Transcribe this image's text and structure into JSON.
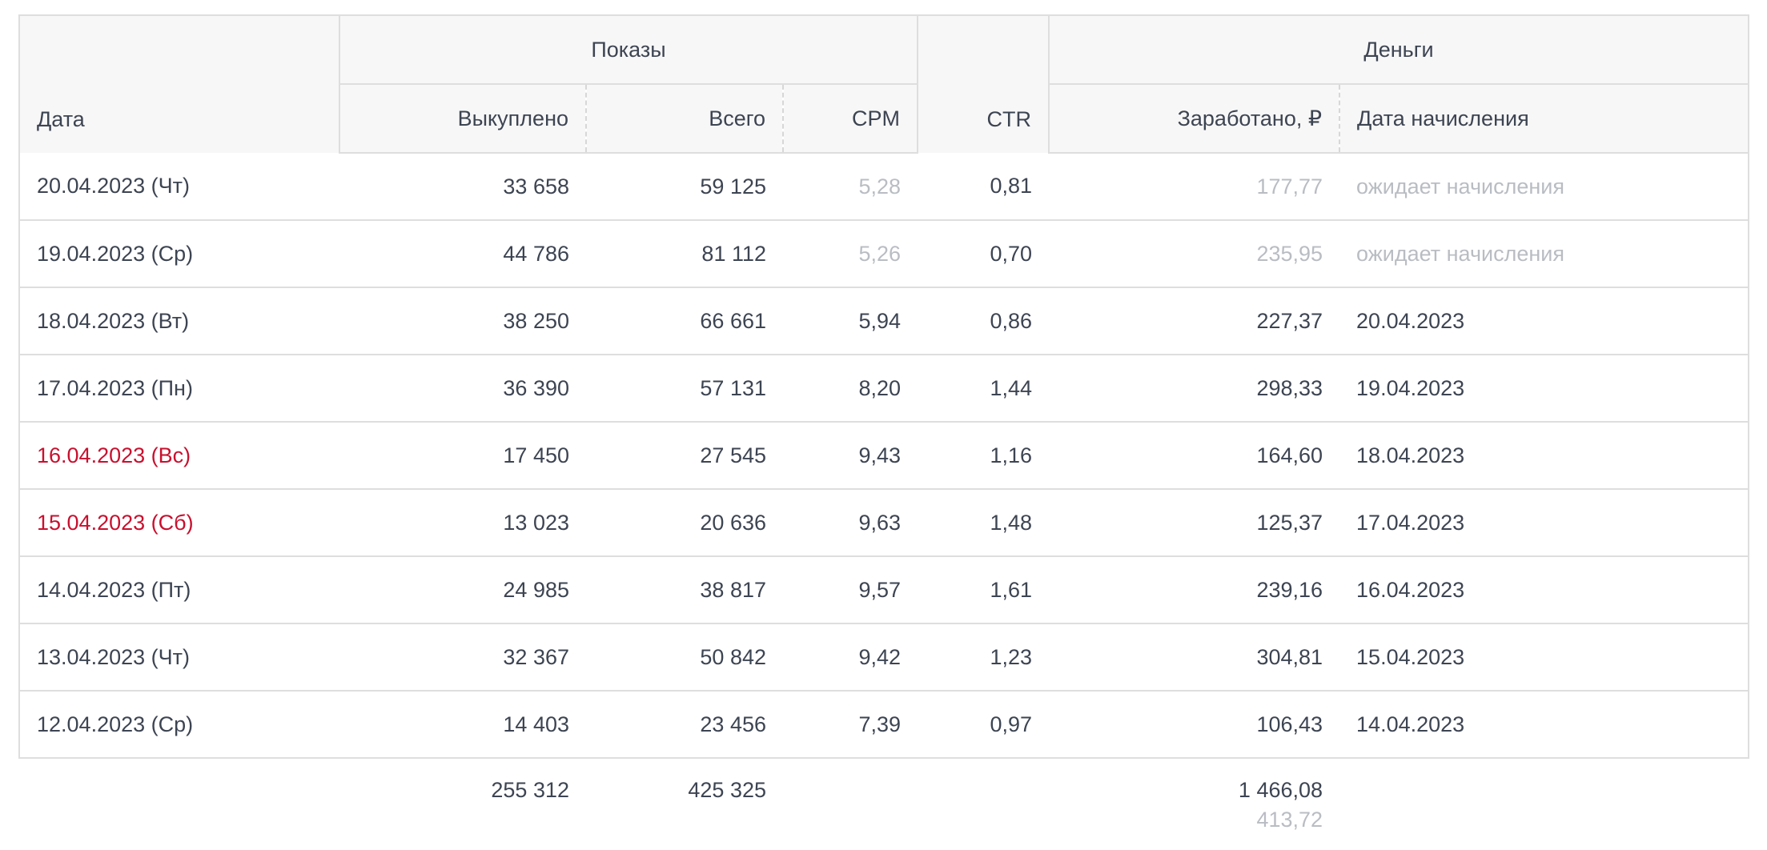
{
  "headers": {
    "date": "Дата",
    "group_impressions": "Показы",
    "purchased": "Выкуплено",
    "total": "Всего",
    "cpm": "CPM",
    "ctr": "CTR",
    "group_money": "Деньги",
    "earned": "Заработано, ₽",
    "accrual_date": "Дата начисления"
  },
  "rows": [
    {
      "date": "20.04.2023 (Чт)",
      "purchased": "33 658",
      "total": "59 125",
      "cpm": "5,28",
      "ctr": "0,81",
      "earned": "177,77",
      "accrual": "ожидает начисления",
      "pending": true,
      "weekend": false
    },
    {
      "date": "19.04.2023 (Ср)",
      "purchased": "44 786",
      "total": "81 112",
      "cpm": "5,26",
      "ctr": "0,70",
      "earned": "235,95",
      "accrual": "ожидает начисления",
      "pending": true,
      "weekend": false
    },
    {
      "date": "18.04.2023 (Вт)",
      "purchased": "38 250",
      "total": "66 661",
      "cpm": "5,94",
      "ctr": "0,86",
      "earned": "227,37",
      "accrual": "20.04.2023",
      "pending": false,
      "weekend": false
    },
    {
      "date": "17.04.2023 (Пн)",
      "purchased": "36 390",
      "total": "57 131",
      "cpm": "8,20",
      "ctr": "1,44",
      "earned": "298,33",
      "accrual": "19.04.2023",
      "pending": false,
      "weekend": false
    },
    {
      "date": "16.04.2023 (Вс)",
      "purchased": "17 450",
      "total": "27 545",
      "cpm": "9,43",
      "ctr": "1,16",
      "earned": "164,60",
      "accrual": "18.04.2023",
      "pending": false,
      "weekend": true
    },
    {
      "date": "15.04.2023 (Сб)",
      "purchased": "13 023",
      "total": "20 636",
      "cpm": "9,63",
      "ctr": "1,48",
      "earned": "125,37",
      "accrual": "17.04.2023",
      "pending": false,
      "weekend": true
    },
    {
      "date": "14.04.2023 (Пт)",
      "purchased": "24 985",
      "total": "38 817",
      "cpm": "9,57",
      "ctr": "1,61",
      "earned": "239,16",
      "accrual": "16.04.2023",
      "pending": false,
      "weekend": false
    },
    {
      "date": "13.04.2023 (Чт)",
      "purchased": "32 367",
      "total": "50 842",
      "cpm": "9,42",
      "ctr": "1,23",
      "earned": "304,81",
      "accrual": "15.04.2023",
      "pending": false,
      "weekend": false
    },
    {
      "date": "12.04.2023 (Ср)",
      "purchased": "14 403",
      "total": "23 456",
      "cpm": "7,39",
      "ctr": "0,97",
      "earned": "106,43",
      "accrual": "14.04.2023",
      "pending": false,
      "weekend": false
    }
  ],
  "totals": {
    "purchased": "255 312",
    "total": "425 325",
    "earned": "1 466,08",
    "earned_pending": "413,72"
  },
  "colors": {
    "weekend": "#c8102e",
    "muted": "#b9bdc3",
    "text": "#3d4452",
    "border": "#dedede",
    "header_bg": "#f7f7f7"
  }
}
